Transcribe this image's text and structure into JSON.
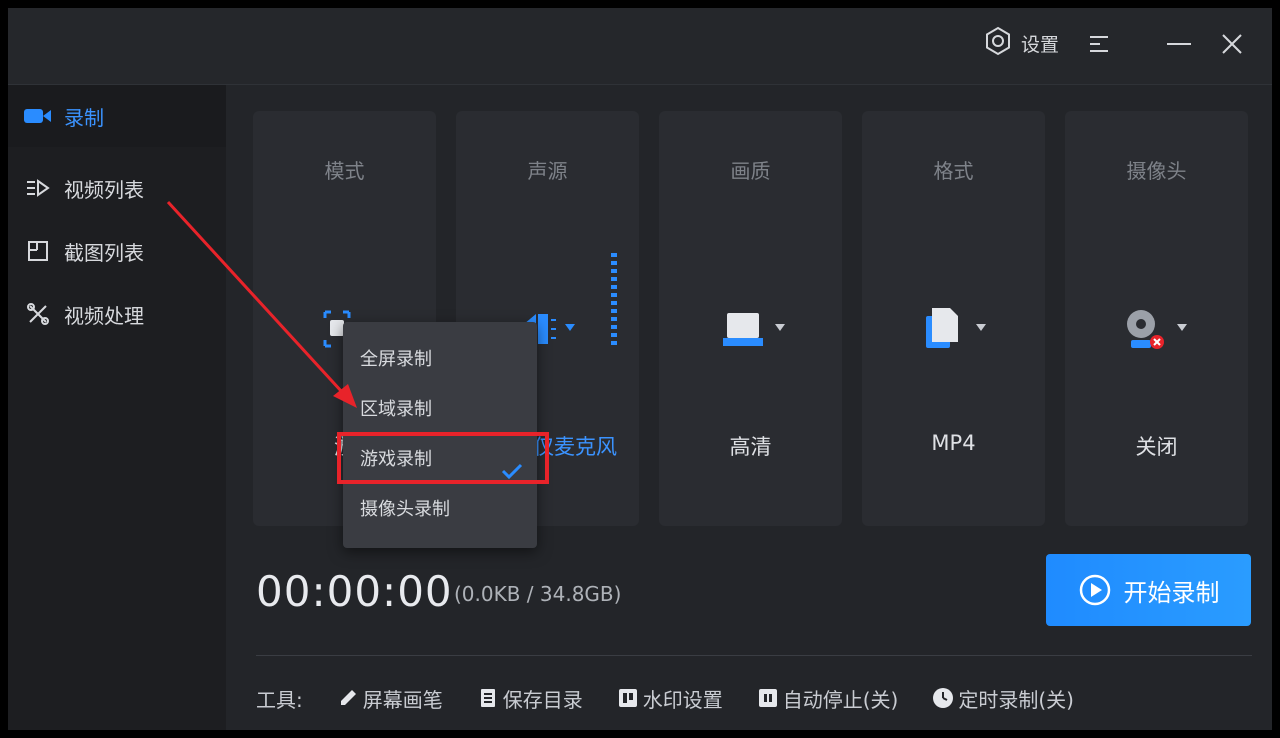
{
  "titlebar": {
    "settings_label": "设置"
  },
  "sidebar": {
    "items": [
      {
        "label": "录制",
        "active": true
      },
      {
        "label": "视频列表"
      },
      {
        "label": "截图列表"
      },
      {
        "label": "视频处理"
      }
    ]
  },
  "cards": [
    {
      "title": "模式",
      "value": "游"
    },
    {
      "title": "声源",
      "value": "仅麦克风"
    },
    {
      "title": "画质",
      "value": "高清"
    },
    {
      "title": "格式",
      "value": "MP4"
    },
    {
      "title": "摄像头",
      "value": "关闭"
    }
  ],
  "status": {
    "timer": "00:00:00",
    "size": "(0.0KB / 34.8GB)"
  },
  "start_button": {
    "label": "开始录制"
  },
  "tools": {
    "label": "工具:",
    "items": [
      {
        "label": "屏幕画笔"
      },
      {
        "label": "保存目录"
      },
      {
        "label": "水印设置"
      },
      {
        "label": "自动停止(关)"
      },
      {
        "label": "定时录制(关)"
      }
    ]
  },
  "mode_menu": {
    "items": [
      {
        "label": "全屏录制"
      },
      {
        "label": "区域录制"
      },
      {
        "label": "游戏录制",
        "selected": true
      },
      {
        "label": "摄像头录制"
      }
    ]
  },
  "colors": {
    "accent": "#2a8cff",
    "highlight": "#e8232a",
    "background": "#232529"
  }
}
